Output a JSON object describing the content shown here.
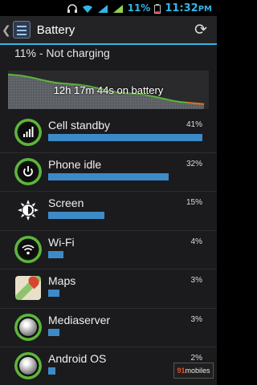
{
  "status_bar": {
    "battery_percent": "11%",
    "time": "11:32",
    "time_suffix": "PM",
    "icons": [
      "headset-icon",
      "wifi-icon",
      "signal-icon",
      "signal-icon-2",
      "battery-icon"
    ]
  },
  "action_bar": {
    "title": "Battery",
    "back_icon": "chevron-left-icon",
    "refresh_icon": "refresh-icon"
  },
  "summary": {
    "text": "11% - Not charging"
  },
  "graph": {
    "label": "12h 17m 44s on battery",
    "level_start": 0.9,
    "level_end": 0.11
  },
  "usage": [
    {
      "name": "Cell standby",
      "percent": "41%",
      "value": 41,
      "icon": "cell-standby-icon"
    },
    {
      "name": "Phone idle",
      "percent": "32%",
      "value": 32,
      "icon": "power-icon"
    },
    {
      "name": "Screen",
      "percent": "15%",
      "value": 15,
      "icon": "brightness-icon"
    },
    {
      "name": "Wi-Fi",
      "percent": "4%",
      "value": 4,
      "icon": "wifi-icon"
    },
    {
      "name": "Maps",
      "percent": "3%",
      "value": 3,
      "icon": "maps-icon"
    },
    {
      "name": "Mediaserver",
      "percent": "3%",
      "value": 3,
      "icon": "mediaserver-icon"
    },
    {
      "name": "Android OS",
      "percent": "2%",
      "value": 2,
      "icon": "android-os-icon"
    }
  ],
  "watermark": {
    "brand_a": "91",
    "brand_b": "mobiles"
  },
  "colors": {
    "accent": "#33b5e5",
    "bar": "#3d8ac9",
    "graph_line": "#5db53a"
  }
}
